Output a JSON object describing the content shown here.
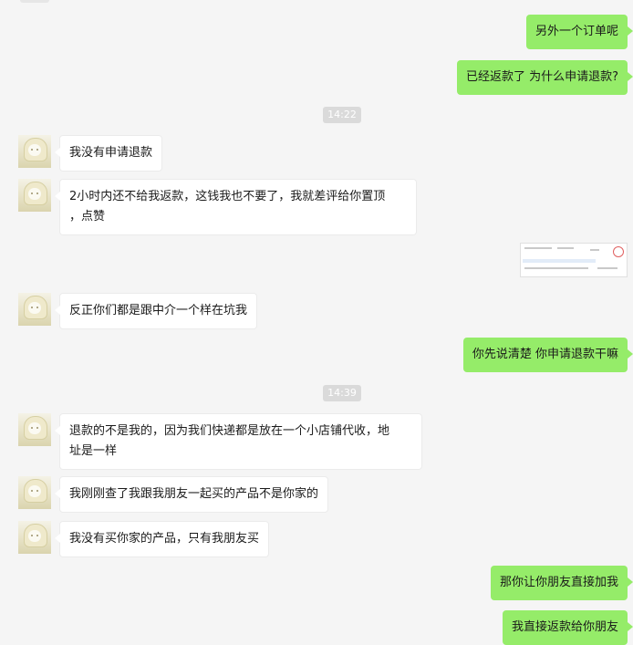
{
  "chat": {
    "messages": [
      {
        "side": "out",
        "text": "另外一个订单呢"
      },
      {
        "side": "out",
        "text": "已经返款了 为什么申请退款?"
      },
      {
        "type": "time",
        "text": "14:22"
      },
      {
        "side": "in",
        "text": "我没有申请退款"
      },
      {
        "side": "in",
        "text": "2小时内还不给我返款，这钱我也不要了，我就差评给你置顶\n，点赞"
      },
      {
        "side": "out",
        "type": "image",
        "alt": "screenshot"
      },
      {
        "side": "in",
        "text": "反正你们都是跟中介一个样在坑我"
      },
      {
        "side": "out",
        "text": "你先说清楚 你申请退款干嘛"
      },
      {
        "type": "time",
        "text": "14:39"
      },
      {
        "side": "in",
        "text": "退款的不是我的，因为我们快递都是放在一个小店铺代收，地\n址是一样"
      },
      {
        "side": "in",
        "text": "我刚刚查了我跟我朋友一起买的产品不是你家的"
      },
      {
        "side": "in",
        "text": "我没有买你家的产品，只有我朋友买"
      },
      {
        "side": "out",
        "text": "那你让你朋友直接加我"
      },
      {
        "side": "out",
        "text": "我直接返款给你朋友"
      }
    ]
  },
  "colors": {
    "outgoing": "#95ec69",
    "incoming": "#ffffff",
    "background": "#f5f5f5",
    "timestamp": "#dadada"
  }
}
